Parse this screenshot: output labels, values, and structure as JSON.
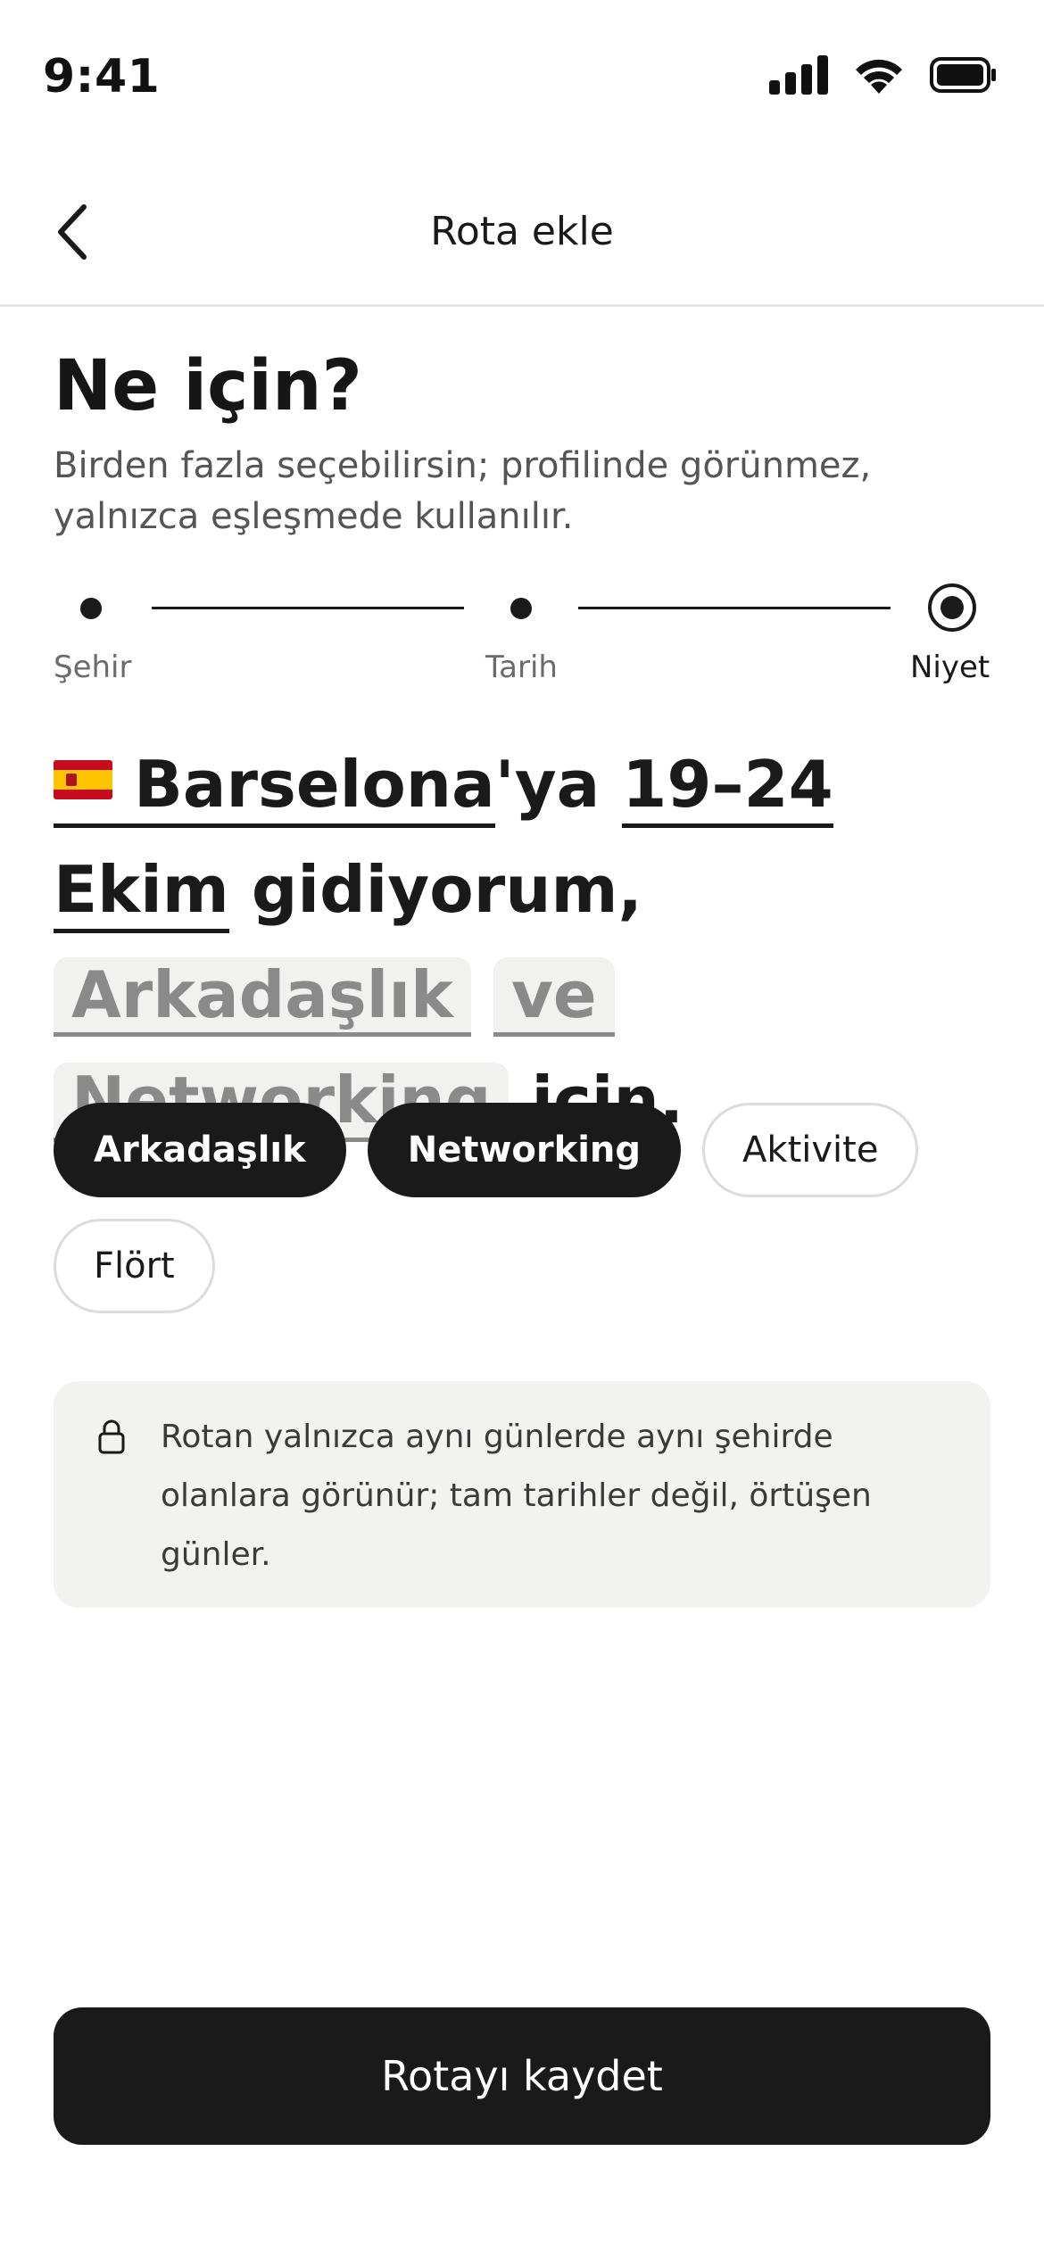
{
  "status_bar": {
    "time": "9:41"
  },
  "nav": {
    "title": "Rota ekle"
  },
  "header": {
    "title": "Ne için?",
    "subtitle": "Birden fazla seçebilirsin; profilinde görünmez, yalnızca eşleşmede kullanılır."
  },
  "stepper": {
    "steps": [
      {
        "label": "Şehir"
      },
      {
        "label": "Tarih"
      },
      {
        "label": "Niyet"
      }
    ],
    "current_step": 3
  },
  "sentence": {
    "city": "Barselona",
    "city_suffix": "'ya",
    "dates": "19–24 Ekim",
    "verb": "gidiyorum,",
    "intent_1": "Arkadaşlık",
    "conjunction": "ve",
    "intent_2": "Networking",
    "ending": "için."
  },
  "chips": [
    {
      "label": "Arkadaşlık",
      "selected": true
    },
    {
      "label": "Networking",
      "selected": true
    },
    {
      "label": "Aktivite",
      "selected": false
    },
    {
      "label": "Flört",
      "selected": false
    }
  ],
  "info": {
    "text": "Rotan yalnızca aynı günlerde aynı şehirde olanlara görünür; tam tarihler değil, örtüşen günler."
  },
  "cta": {
    "label": "Rotayı kaydet"
  },
  "colors": {
    "primary": "#1a1a1a",
    "muted": "#8a8a8a",
    "surface": "#f2f2f1"
  }
}
